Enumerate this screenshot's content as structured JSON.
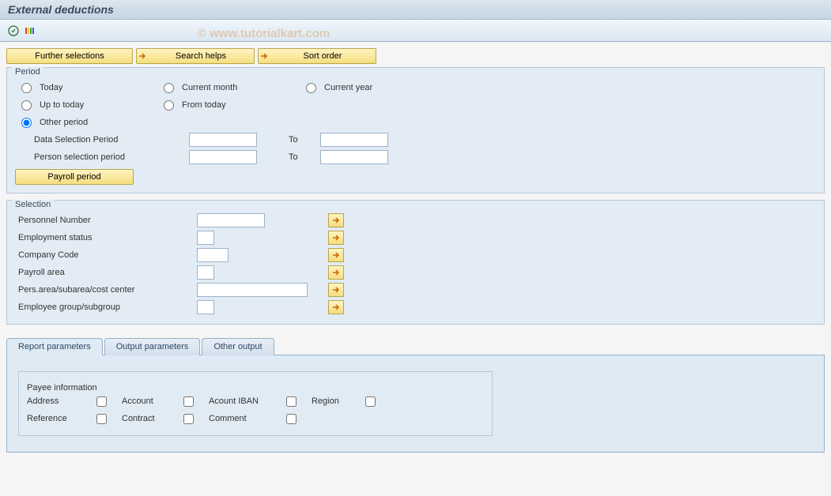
{
  "title": "External deductions",
  "watermark": "© www.tutorialkart.com",
  "buttons": {
    "further_selections": "Further selections",
    "search_helps": "Search helps",
    "sort_order": "Sort order",
    "payroll_period": "Payroll period"
  },
  "period": {
    "legend": "Period",
    "today": "Today",
    "current_month": "Current month",
    "current_year": "Current year",
    "up_to_today": "Up to today",
    "from_today": "From today",
    "other_period": "Other period",
    "data_selection": "Data Selection Period",
    "person_selection": "Person selection period",
    "to": "To",
    "data_from": "",
    "data_to": "",
    "person_from": "",
    "person_to": ""
  },
  "selection": {
    "legend": "Selection",
    "personnel_number": "Personnel Number",
    "employment_status": "Employment status",
    "company_code": "Company Code",
    "payroll_area": "Payroll area",
    "pers_area": "Pers.area/subarea/cost center",
    "employee_group": "Employee group/subgroup",
    "v_personnel": "",
    "v_emp": "",
    "v_company": "",
    "v_payroll": "",
    "v_pers": "",
    "v_group": ""
  },
  "tabs": {
    "report": "Report parameters",
    "output": "Output parameters",
    "other": "Other output"
  },
  "payee": {
    "legend": "Payee information",
    "address": "Address",
    "account": "Account",
    "iban": "Acount IBAN",
    "region": "Region",
    "reference": "Reference",
    "contract": "Contract",
    "comment": "Comment"
  }
}
